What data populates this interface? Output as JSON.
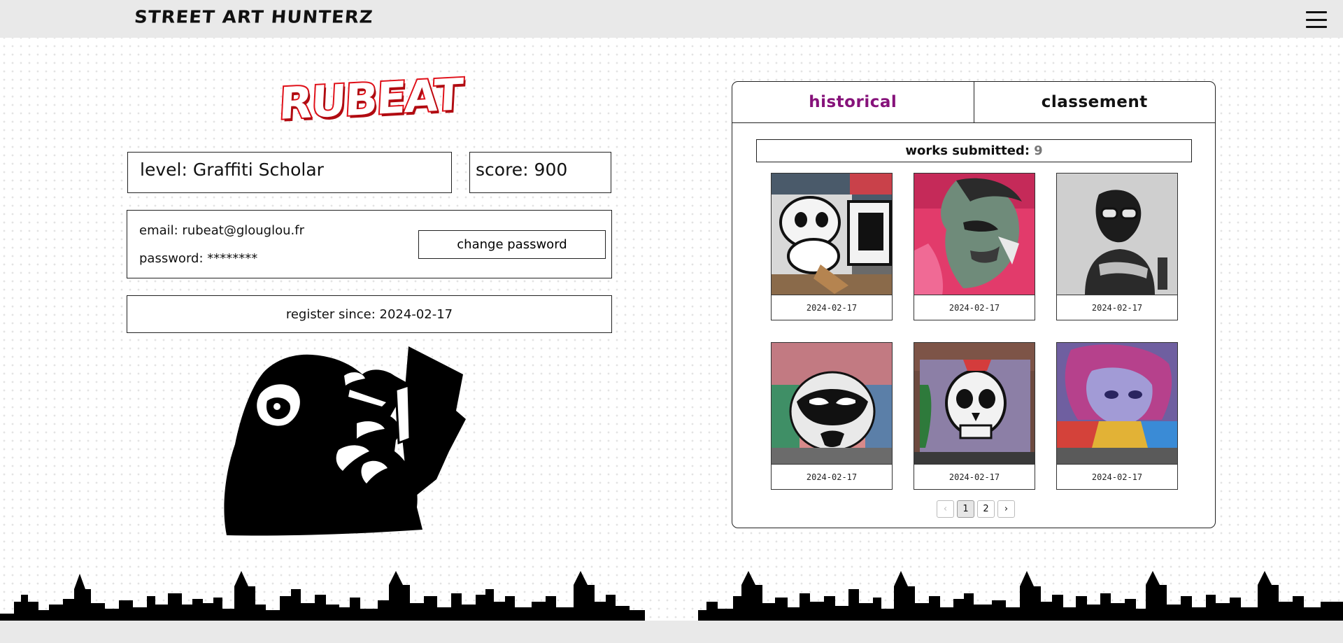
{
  "header": {
    "brand": "STREET ART HUNTERZ",
    "menu_icon": "hamburger-menu-icon"
  },
  "profile": {
    "username": "RUBEAT",
    "level": "level: Graffiti Scholar",
    "score": "score: 900",
    "email": "email: rubeat@glouglou.fr",
    "password": "password: ********",
    "change_password_label": "change password",
    "register_since": "register since: 2024-02-17",
    "illustration": "thinking-monkey-stencil"
  },
  "panel": {
    "tabs": [
      {
        "label": "historical",
        "active": true
      },
      {
        "label": "classement",
        "active": false
      }
    ],
    "works_label": "works submitted:",
    "works_count": "9",
    "works": [
      {
        "date": "2024-02-17",
        "subject": "cartoon gorilla graffiti"
      },
      {
        "date": "2024-02-17",
        "subject": "pink portrait mural"
      },
      {
        "date": "2024-02-17",
        "subject": "stencil boy with goggles"
      },
      {
        "date": "2024-02-17",
        "subject": "masked face mural"
      },
      {
        "date": "2024-02-17",
        "subject": "skull graffiti TMF"
      },
      {
        "date": "2024-02-17",
        "subject": "purple character mural"
      }
    ],
    "pagination": {
      "prev": "‹",
      "pages": [
        "1",
        "2"
      ],
      "current": "1",
      "next": "›"
    }
  },
  "colors": {
    "accent": "#86127a",
    "logo_red": "#e01019",
    "header_bg": "#e9e9e9"
  }
}
